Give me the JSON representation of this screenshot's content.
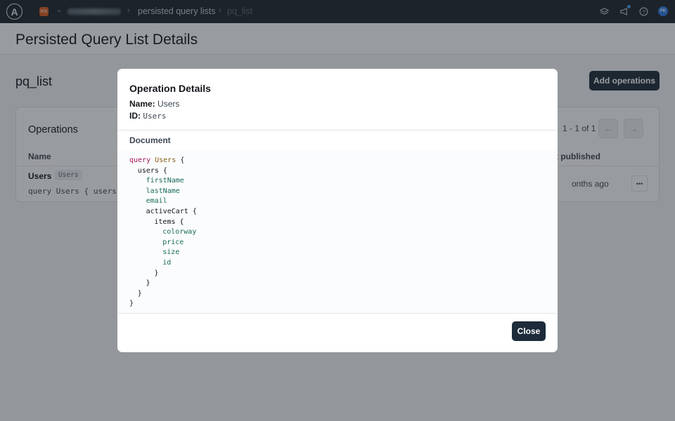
{
  "topnav": {
    "logo_letter": "A",
    "org_initials": "KG",
    "breadcrumb": [
      "persisted query lists",
      "pq_list"
    ]
  },
  "page": {
    "title": "Persisted Query List Details",
    "list_name": "pq_list",
    "add_operations_label": "Add operations"
  },
  "operations_card": {
    "title": "Operations",
    "pagination_text": "1 - 1 of 1",
    "columns": [
      "Name",
      "t published"
    ],
    "rows": [
      {
        "name": "Users",
        "id": "Users",
        "preview": "query Users { users",
        "published": "onths ago"
      }
    ]
  },
  "modal": {
    "title": "Operation Details",
    "name_label": "Name:",
    "name_value": "Users",
    "id_label": "ID:",
    "id_value": "Users",
    "document_label": "Document",
    "close_label": "Close",
    "code_lines": [
      {
        "indent": 0,
        "tokens": [
          {
            "t": "query ",
            "c": "kw"
          },
          {
            "t": "Users",
            "c": "opname"
          },
          {
            "t": " {",
            "c": ""
          }
        ]
      },
      {
        "indent": 1,
        "tokens": [
          {
            "t": "users",
            "c": ""
          },
          {
            "t": " {",
            "c": ""
          }
        ]
      },
      {
        "indent": 2,
        "tokens": [
          {
            "t": "firstName",
            "c": "field"
          }
        ]
      },
      {
        "indent": 2,
        "tokens": [
          {
            "t": "lastName",
            "c": "field"
          }
        ]
      },
      {
        "indent": 2,
        "tokens": [
          {
            "t": "email",
            "c": "field"
          }
        ]
      },
      {
        "indent": 2,
        "tokens": [
          {
            "t": "activeCart",
            "c": ""
          },
          {
            "t": " {",
            "c": ""
          }
        ]
      },
      {
        "indent": 3,
        "tokens": [
          {
            "t": "items",
            "c": ""
          },
          {
            "t": " {",
            "c": ""
          }
        ]
      },
      {
        "indent": 4,
        "tokens": [
          {
            "t": "colorway",
            "c": "field"
          }
        ]
      },
      {
        "indent": 4,
        "tokens": [
          {
            "t": "price",
            "c": "field"
          }
        ]
      },
      {
        "indent": 4,
        "tokens": [
          {
            "t": "size",
            "c": "field"
          }
        ]
      },
      {
        "indent": 4,
        "tokens": [
          {
            "t": "id",
            "c": "field"
          }
        ]
      },
      {
        "indent": 3,
        "tokens": [
          {
            "t": "}",
            "c": ""
          }
        ]
      },
      {
        "indent": 2,
        "tokens": [
          {
            "t": "}",
            "c": ""
          }
        ]
      },
      {
        "indent": 1,
        "tokens": [
          {
            "t": "}",
            "c": ""
          }
        ]
      },
      {
        "indent": 0,
        "tokens": [
          {
            "t": "}",
            "c": ""
          }
        ]
      }
    ]
  }
}
